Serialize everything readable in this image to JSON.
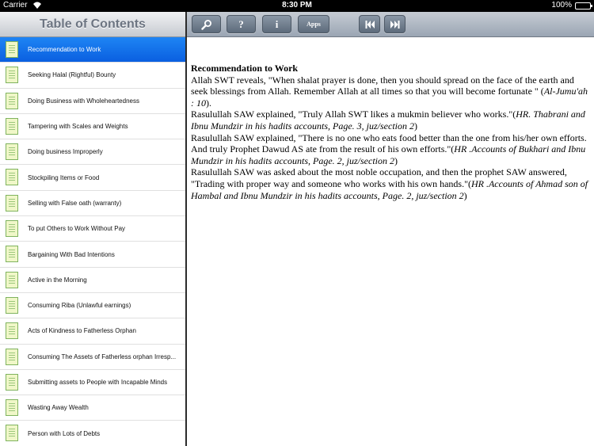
{
  "status_bar": {
    "carrier": "Carrier",
    "time": "8:30 PM",
    "battery": "100%"
  },
  "sidebar": {
    "title": "Table of Contents",
    "items": [
      {
        "label": "Recommendation to Work",
        "selected": true
      },
      {
        "label": "Seeking Halal (Rightful) Bounty"
      },
      {
        "label": "Doing Business with Wholeheartedness"
      },
      {
        "label": "Tampering with Scales and Weights"
      },
      {
        "label": "Doing business Improperly"
      },
      {
        "label": "Stockpiling Items or Food"
      },
      {
        "label": "Selling with False oath (warranty)"
      },
      {
        "label": "To put Others to Work Without Pay"
      },
      {
        "label": "Bargaining With Bad Intentions"
      },
      {
        "label": "Active in the Morning"
      },
      {
        "label": "Consuming Riba (Unlawful earnings)"
      },
      {
        "label": "Acts of Kindness to Fatherless Orphan"
      },
      {
        "label": "Consuming The Assets of Fatherless orphan Irresp..."
      },
      {
        "label": "Submitting assets to People with Incapable Minds"
      },
      {
        "label": "Wasting Away Wealth"
      },
      {
        "label": "Person with Lots of Debts"
      }
    ]
  },
  "toolbar": {
    "search_icon": "search-icon",
    "help_label": "?",
    "info_label": "i",
    "apps_label": "Apps",
    "prev_icon": "skip-back-icon",
    "next_icon": "skip-forward-icon"
  },
  "content": {
    "heading": "Recommendation to Work",
    "p1_text": "Allah SWT reveals, \"When shalat prayer is done, then you should spread on the face of the earth and seek blessings from Allah.  Remember Allah at all times so that you will become fortunate \" (",
    "p1_cite": "Al-Jumu'ah : 10",
    "p1_end": ").",
    "p2_text": "Rasulullah SAW explained, \"Truly Allah SWT likes a mukmin believer who works.\"(",
    "p2_cite": "HR. Thabrani and Ibnu Mundzir in his hadits accounts, Page. 3, juz/section 2",
    "p2_end": ")",
    "p3_text": "Rasulullah SAW explained, \"There is no one who eats food better than the one from his/her own efforts. And truly Prophet Dawud AS ate from the result of his own efforts.\"(",
    "p3_cite": "HR .Accounts of Bukhari and Ibnu Mundzir in his hadits accounts, Page. 2, juz/section 2",
    "p3_end": ")",
    "p4_text": "Rasulullah SAW was asked about the most noble occupation, and then the prophet SAW answered, \"Trading with proper way and someone who works with his own hands.\"(",
    "p4_cite": "HR .Accounts of Ahmad son of Hambal and Ibnu Mundzir in his hadits accounts, Page. 2, juz/section 2",
    "p4_end": ")"
  }
}
